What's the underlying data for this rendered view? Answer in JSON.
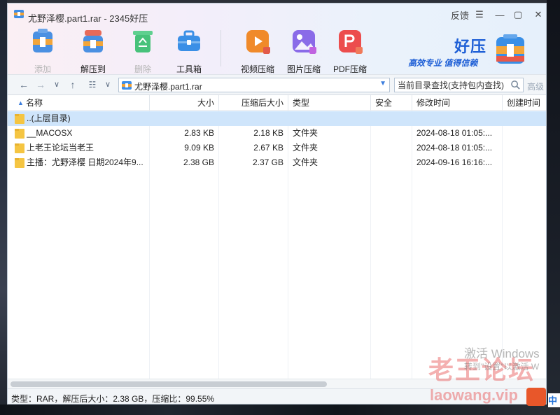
{
  "window": {
    "title": "尤野泽樱.part1.rar - 2345好压",
    "controls": {
      "feedback": "反馈",
      "menu": "☰",
      "minimize": "—",
      "maximize": "▢",
      "close": "✕"
    }
  },
  "toolbar": {
    "items": [
      {
        "label": "添加",
        "icon": "add-icon",
        "enabled": false
      },
      {
        "label": "解压到",
        "icon": "extract-icon",
        "enabled": true
      },
      {
        "label": "删除",
        "icon": "recycle-icon",
        "enabled": false
      },
      {
        "label": "工具箱",
        "icon": "toolbox-icon",
        "enabled": true
      },
      {
        "label": "视频压缩",
        "icon": "video-compress-icon",
        "enabled": true
      },
      {
        "label": "图片压缩",
        "icon": "image-compress-icon",
        "enabled": true
      },
      {
        "label": "PDF压缩",
        "icon": "pdf-compress-icon",
        "enabled": true
      }
    ]
  },
  "brand": {
    "name": "好压",
    "slogan": "高效专业 值得信赖"
  },
  "address": {
    "path": "尤野泽樱.part1.rar",
    "search_placeholder": "当前目录查找(支持包内查找)",
    "advanced": "高级"
  },
  "columns": [
    "名称",
    "大小",
    "压缩后大小",
    "类型",
    "安全",
    "修改时间",
    "创建时间"
  ],
  "rows": [
    {
      "name": "..(上层目录)",
      "size": "",
      "packed": "",
      "type": "",
      "security": "",
      "modified": "",
      "created": "",
      "selected": true
    },
    {
      "name": "__MACOSX",
      "size": "2.83 KB",
      "packed": "2.18 KB",
      "type": "文件夹",
      "security": "",
      "modified": "2024-08-18 01:05:...",
      "created": ""
    },
    {
      "name": "上老王论坛当老王",
      "size": "9.09 KB",
      "packed": "2.67 KB",
      "type": "文件夹",
      "security": "",
      "modified": "2024-08-18 01:05:...",
      "created": ""
    },
    {
      "name": "主播：尤野泽樱 日期2024年9...",
      "size": "2.38 GB",
      "packed": "2.37 GB",
      "type": "文件夹",
      "security": "",
      "modified": "2024-09-16 16:16:...",
      "created": ""
    }
  ],
  "status": {
    "text": "类型：RAR，解压后大小：2.38 GB，压缩比：99.55%"
  },
  "overlay": {
    "activate_title": "激活 Windows",
    "activate_hint": "转到\"设置\"以激活 W",
    "watermark": "老王论坛",
    "watermark_url": "laowang.vip",
    "ime": "中"
  },
  "colors": {
    "accent": "#1e5fd6",
    "selection": "#cfe5fb",
    "folder": "#f5c542"
  }
}
